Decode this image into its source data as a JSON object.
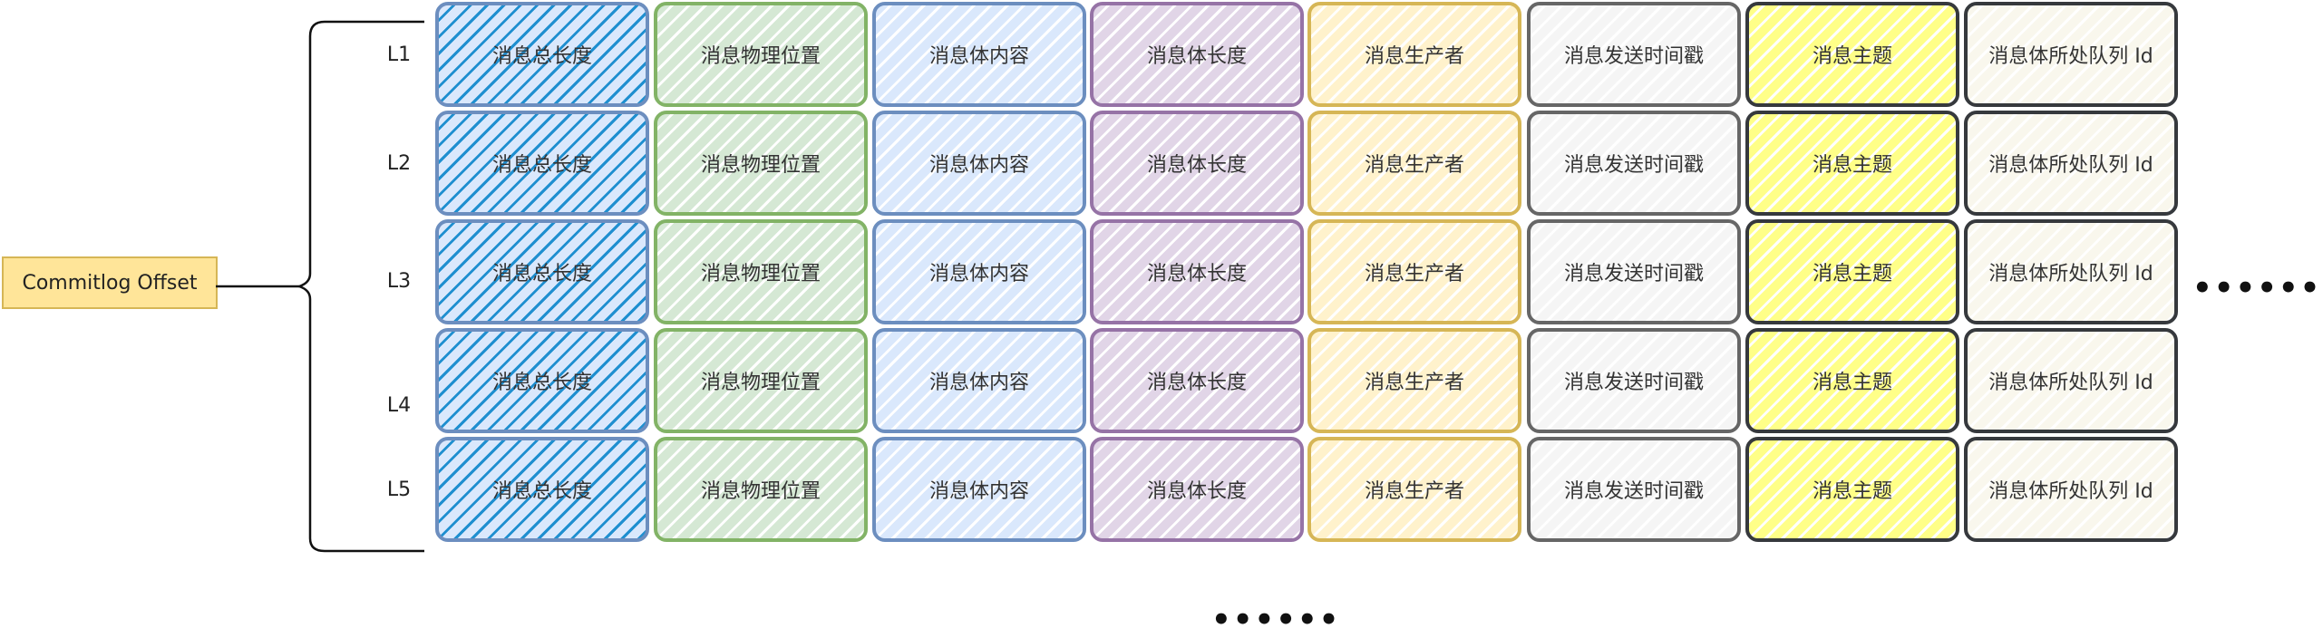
{
  "offset_label": "Commitlog Offset",
  "row_labels": [
    "L1",
    "L2",
    "L3",
    "L4",
    "L5"
  ],
  "columns": [
    {
      "label": "消息总长度",
      "fill": "#dae8fc",
      "stroke": "#6c8ebf",
      "hatch": "#1f8fd0"
    },
    {
      "label": "消息物理位置",
      "fill": "#d5e8d4",
      "stroke": "#82b366",
      "hatch": "#ffffff"
    },
    {
      "label": "消息体内容",
      "fill": "#dae8fc",
      "stroke": "#6c8ebf",
      "hatch": "#ffffff"
    },
    {
      "label": "消息体长度",
      "fill": "#e1d5e7",
      "stroke": "#9673a6",
      "hatch": "#ffffff"
    },
    {
      "label": "消息生产者",
      "fill": "#fff2cc",
      "stroke": "#d6b656",
      "hatch": "#ffffff"
    },
    {
      "label": "消息发送时间戳",
      "fill": "#f5f5f5",
      "stroke": "#666666",
      "hatch": "#ffffff"
    },
    {
      "label": "消息主题",
      "fill": "#ffff88",
      "stroke": "#36393d",
      "hatch": "#ffffff"
    },
    {
      "label": "消息体所处队列 Id",
      "fill": "#f9f7ed",
      "stroke": "#36393d",
      "hatch": "#ffffff"
    }
  ],
  "ellipsis_right": "••••••",
  "ellipsis_bottom": "••••••"
}
